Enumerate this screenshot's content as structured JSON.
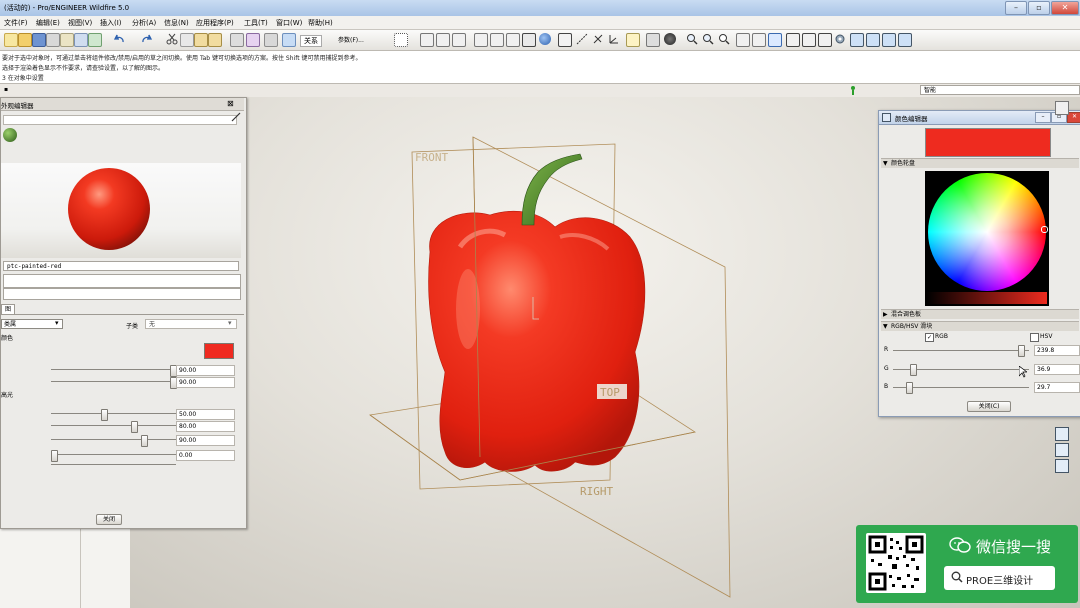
{
  "window": {
    "title": "(活动的) - Pro/ENGINEER Wildfire 5.0"
  },
  "menu": [
    "文件(F)",
    "编辑(E)",
    "视图(V)",
    "插入(I)",
    "分析(A)",
    "信息(N)",
    "应用程序(P)",
    "工具(T)",
    "窗口(W)",
    "帮助(H)"
  ],
  "toolbar": {
    "relation_label": "关系",
    "param_label": "参数(F)..."
  },
  "messages": [
    "要对于选中对象时，可通过单击将组件修改/禁用/启用的草之间切换。使用 Tab 键可切换选项的方案。按住 Shift 键可禁用捕捉到参考。",
    "选择于渲染着色显示不作要求，请查验设置，以了解的图示。",
    "3 在对象中设置"
  ],
  "status": {
    "filter_value": "智能"
  },
  "appearance_editor": {
    "title": "外观编辑器",
    "material_name": "ptc-painted-red",
    "tab_label": "图",
    "class_label": "类属",
    "subclass_label": "子类",
    "subclass_value": "无",
    "color_label": "颜色",
    "highlight_label": "高光",
    "sliders": [
      {
        "value": "90.00",
        "level": 0.95
      },
      {
        "value": "90.00",
        "level": 0.95
      },
      {
        "value": "50.00",
        "level": 0.5
      },
      {
        "value": "80.00",
        "level": 0.8
      },
      {
        "value": "90.00",
        "level": 0.9
      },
      {
        "value": "0.00",
        "level": 0.0
      }
    ],
    "close_label": "关闭",
    "color_swatch": "#ef2a20"
  },
  "viewport": {
    "datum_front": "FRONT",
    "datum_top": "TOP",
    "datum_right": "RIGHT",
    "model_color": "#f02a1e",
    "stem_color": "#4f8a2a"
  },
  "color_editor": {
    "title": "颜色编辑器",
    "preview_color": "#ee2b1f",
    "section_wheel": "颜色轮盘",
    "section_mixer": "混合调色板",
    "section_rgbhsv": "RGB/HSV 滑块",
    "rgb_label": "RGB",
    "hsv_label": "HSV",
    "rgb_checked": true,
    "hsv_checked": false,
    "channels": [
      {
        "label": "R",
        "value": "239.8",
        "level": 0.94
      },
      {
        "label": "G",
        "value": "36.9",
        "level": 0.145
      },
      {
        "label": "B",
        "value": "29.7",
        "level": 0.116
      }
    ],
    "close_label": "关闭(C)"
  },
  "wechat": {
    "title": "微信搜一搜",
    "search": "PROE三维设计"
  }
}
